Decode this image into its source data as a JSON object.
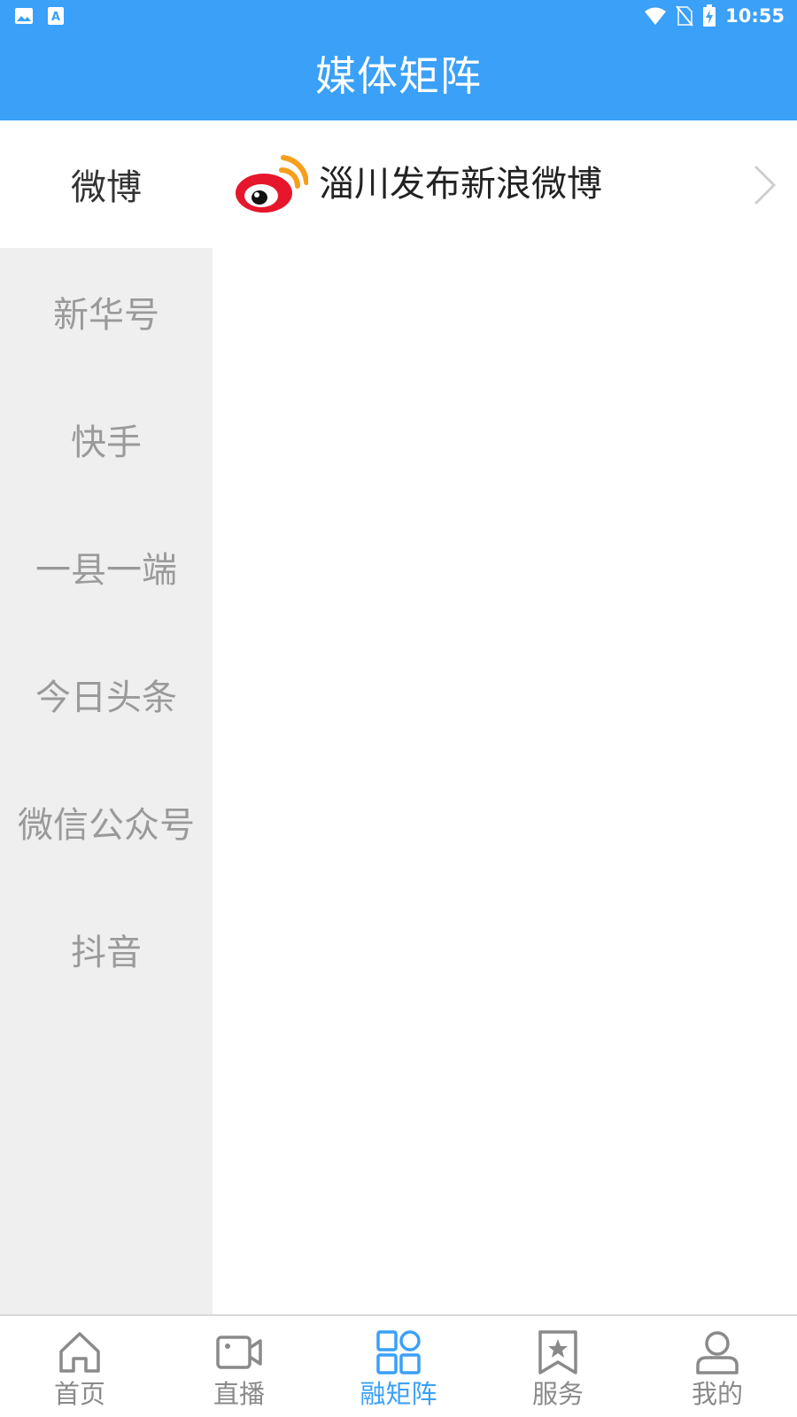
{
  "status_bar": {
    "time": "10:55",
    "left_icons": [
      "image-icon",
      "text-app-icon"
    ],
    "right_icons": [
      "wifi-icon",
      "no-sim-icon",
      "battery-charging-icon"
    ]
  },
  "header": {
    "title": "媒体矩阵"
  },
  "sidebar": {
    "items": [
      {
        "label": "微博",
        "active": true
      },
      {
        "label": "新华号",
        "active": false
      },
      {
        "label": "快手",
        "active": false
      },
      {
        "label": "一县一端",
        "active": false
      },
      {
        "label": "今日头条",
        "active": false
      },
      {
        "label": "微信公众号",
        "active": false
      },
      {
        "label": "抖音",
        "active": false
      }
    ]
  },
  "content": {
    "items": [
      {
        "icon": "weibo-logo-icon",
        "name": "淄川发布新浪微博"
      }
    ]
  },
  "tabbar": {
    "items": [
      {
        "label": "首页",
        "icon": "home-icon",
        "active": false
      },
      {
        "label": "直播",
        "icon": "video-camera-icon",
        "active": false
      },
      {
        "label": "融矩阵",
        "icon": "grid-icon",
        "active": true
      },
      {
        "label": "服务",
        "icon": "bookmark-star-icon",
        "active": false
      },
      {
        "label": "我的",
        "icon": "user-icon",
        "active": false
      }
    ]
  },
  "colors": {
    "primary": "#3aa0f8",
    "sidebar_bg": "#efefef",
    "inactive_text": "#9a9a9a",
    "weibo_red": "#e6162d",
    "weibo_orange": "#f79e1b"
  }
}
